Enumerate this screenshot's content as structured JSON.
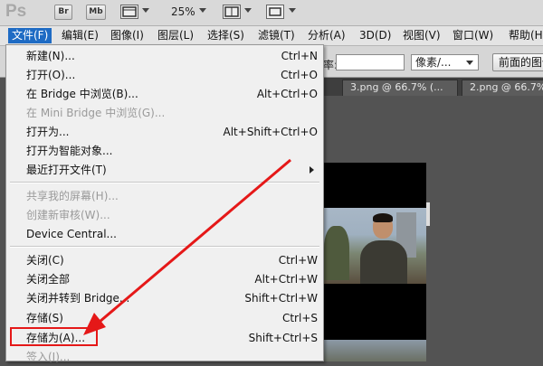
{
  "app": {
    "logo": "Ps"
  },
  "toolbar": {
    "bridge_label": "Br",
    "minibridge_label": "Mb",
    "zoom": "25%"
  },
  "menubar": [
    {
      "label": "文件(F)",
      "active": true
    },
    {
      "label": "编辑(E)"
    },
    {
      "label": "图像(I)"
    },
    {
      "label": "图层(L)"
    },
    {
      "label": "选择(S)"
    },
    {
      "label": "滤镜(T)"
    },
    {
      "label": "分析(A)"
    },
    {
      "label": "3D(D)"
    },
    {
      "label": "视图(V)"
    },
    {
      "label": "窗口(W)"
    },
    {
      "label": "帮助(H)"
    }
  ],
  "options": {
    "resolution_label": "率:",
    "unit_select": "像素/...",
    "front_image_button": "前面的图像"
  },
  "doc_tabs": [
    {
      "label": "3.png @ 66.7% (..."
    },
    {
      "label": "2.png @ 66.7%"
    }
  ],
  "file_menu": [
    {
      "label": "新建(N)...",
      "shortcut": "Ctrl+N"
    },
    {
      "label": "打开(O)...",
      "shortcut": "Ctrl+O"
    },
    {
      "label": "在 Bridge 中浏览(B)...",
      "shortcut": "Alt+Ctrl+O"
    },
    {
      "label": "在 Mini Bridge 中浏览(G)...",
      "shortcut": "",
      "disabled": true
    },
    {
      "label": "打开为...",
      "shortcut": "Alt+Shift+Ctrl+O"
    },
    {
      "label": "打开为智能对象...",
      "shortcut": ""
    },
    {
      "label": "最近打开文件(T)",
      "shortcut": "",
      "submenu": true
    },
    {
      "label": "共享我的屏幕(H)...",
      "shortcut": "",
      "disabled": true
    },
    {
      "label": "创建新审核(W)...",
      "shortcut": "",
      "disabled": true
    },
    {
      "label": "Device Central...",
      "shortcut": ""
    },
    {
      "label": "关闭(C)",
      "shortcut": "Ctrl+W"
    },
    {
      "label": "关闭全部",
      "shortcut": "Alt+Ctrl+W"
    },
    {
      "label": "关闭并转到 Bridge...",
      "shortcut": "Shift+Ctrl+W"
    },
    {
      "label": "存储(S)",
      "shortcut": "Ctrl+S"
    },
    {
      "label": "存储为(A)...",
      "shortcut": "Shift+Ctrl+S",
      "highlighted": true
    },
    {
      "label": "签入(I)...",
      "shortcut": "",
      "disabled": true
    }
  ],
  "colors": {
    "menu_active": "#1e6bc4",
    "annotation_red": "#e51818"
  }
}
